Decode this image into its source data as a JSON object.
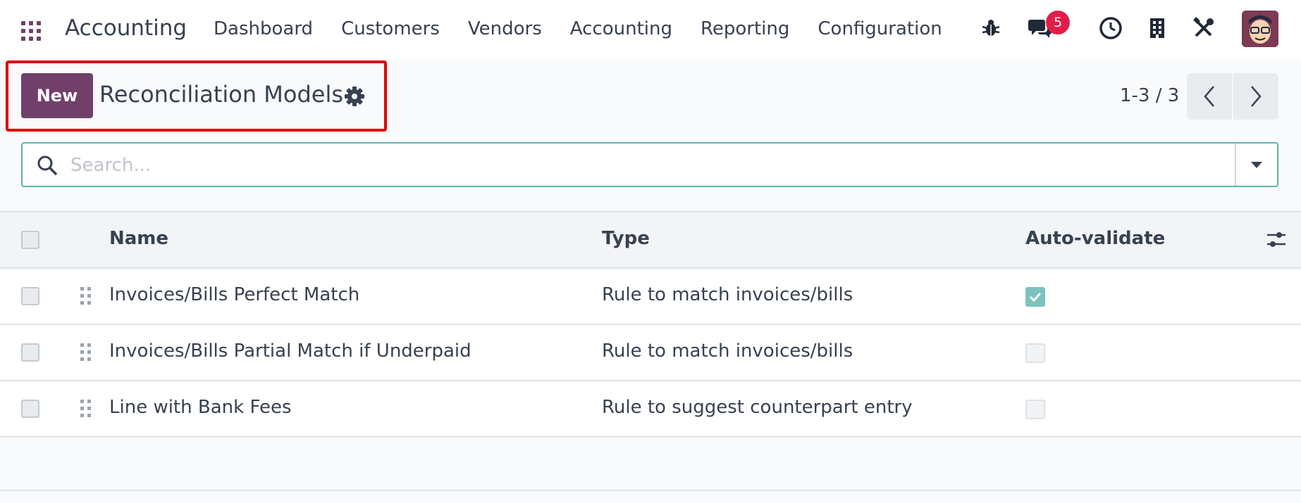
{
  "navbar": {
    "app_name": "Accounting",
    "menu": [
      "Dashboard",
      "Customers",
      "Vendors",
      "Accounting",
      "Reporting",
      "Configuration"
    ],
    "messages_count": "5",
    "icons": [
      "apps-grid-icon",
      "bug-icon",
      "chat-icon",
      "clock-icon",
      "building-icon",
      "tools-icon",
      "avatar"
    ]
  },
  "control_panel": {
    "new_label": "New",
    "title": "Reconciliation Models",
    "pager": "1-3 / 3"
  },
  "search": {
    "placeholder": "Search..."
  },
  "table": {
    "headers": {
      "name": "Name",
      "type": "Type",
      "auto_validate": "Auto-validate"
    },
    "rows": [
      {
        "name": "Invoices/Bills Perfect Match",
        "type": "Rule to match invoices/bills",
        "auto_validate": true
      },
      {
        "name": "Invoices/Bills Partial Match if Underpaid",
        "type": "Rule to match invoices/bills",
        "auto_validate": false
      },
      {
        "name": "Line with Bank Fees",
        "type": "Rule to suggest counterpart entry",
        "auto_validate": false
      }
    ]
  },
  "colors": {
    "brand": "#71406a",
    "accent": "#5eb5a8",
    "badge": "#e11d48",
    "highlight": "#e00000"
  }
}
